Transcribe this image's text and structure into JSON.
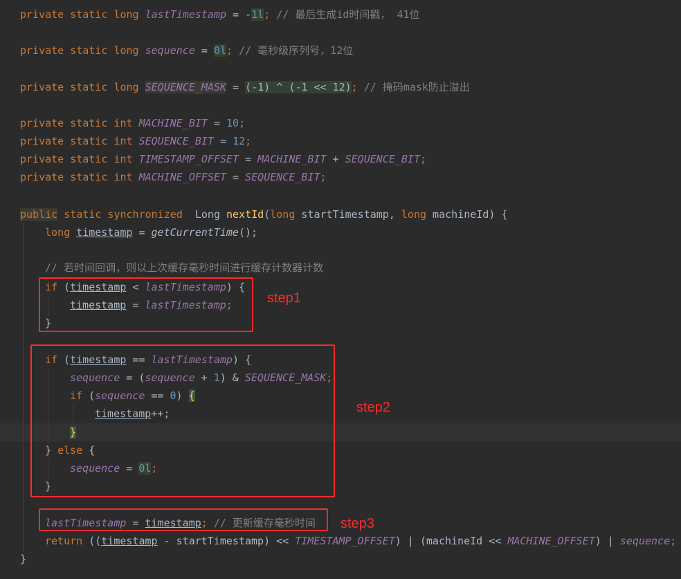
{
  "code": {
    "l1": {
      "a": "private static long ",
      "b": "lastTimestamp",
      "c": " = -",
      "d": "1l",
      "e": "; ",
      "f": "// 最后生成id时间戳， 41位"
    },
    "l2": {
      "a": "private static long ",
      "b": "sequence",
      "c": " = ",
      "d": "0l",
      "e": "; ",
      "f": "// 毫秒级序列号，12位"
    },
    "l3": {
      "a": "private static long ",
      "b": "SEQUENCE_MASK",
      "c": " = ",
      "d": "(-1) ^ (-1 << 12)",
      "e": "; ",
      "f": "// 掩码mask防止溢出"
    },
    "l4": {
      "a": "private static int ",
      "b": "MACHINE_BIT",
      "c": " = ",
      "d": "10",
      "e": ";"
    },
    "l5": {
      "a": "private static int ",
      "b": "SEQUENCE_BIT",
      "c": " = ",
      "d": "12",
      "e": ";"
    },
    "l6": {
      "a": "private static int ",
      "b": "TIMESTAMP_OFFSET",
      "c": " = ",
      "d": "MACHINE_BIT",
      "e": " + ",
      "f": "SEQUENCE_BIT",
      "g": ";"
    },
    "l7": {
      "a": "private static int ",
      "b": "MACHINE_OFFSET",
      "c": " = ",
      "d": "SEQUENCE_BIT",
      "e": ";"
    },
    "l8": {
      "a": "public",
      "b": " static synchronized ",
      "c": " Long ",
      "d": "nextId",
      "e": "(",
      "f": "long",
      "g": " startTimestamp, ",
      "h": "long",
      "i": " machineId) {"
    },
    "l9": {
      "a": "long ",
      "b": "timestamp",
      "c": " = ",
      "d": "getCurrentTime",
      "e": "();"
    },
    "l10": {
      "a": "// 若时间回调，则以上次缓存毫秒时间进行缓存计数器计数"
    },
    "l11": {
      "a": "if",
      "b": " (",
      "c": "timestamp",
      "d": " < ",
      "e": "lastTimestamp",
      "f": ") {"
    },
    "l12": {
      "a": "timestamp",
      "b": " = ",
      "c": "lastTimestamp",
      "d": ";"
    },
    "l13": {
      "a": "}"
    },
    "l14": {
      "a": "if",
      "b": " (",
      "c": "timestamp",
      "d": " == ",
      "e": "lastTimestamp",
      "f": ") {"
    },
    "l15": {
      "a": "sequence",
      "b": " = (",
      "c": "sequence",
      "d": " + ",
      "e": "1",
      "f": ") & ",
      "g": "SEQUENCE_MASK",
      "h": ";"
    },
    "l16": {
      "a": "if",
      "b": " (",
      "c": "sequence",
      "d": " == ",
      "e": "0",
      "f": ") ",
      "g": "{"
    },
    "l17": {
      "a": "timestamp",
      "b": "++;"
    },
    "l18": {
      "a": "}"
    },
    "l19": {
      "a": "} ",
      "b": "else",
      "c": " {"
    },
    "l20": {
      "a": "sequence",
      "b": " = ",
      "c": "0l",
      "d": ";"
    },
    "l21": {
      "a": "}"
    },
    "l22": {
      "a": "lastTimestamp",
      "b": " = ",
      "c": "timestamp",
      "d": "; ",
      "e": "// 更新缓存毫秒时间"
    },
    "l23": {
      "a": "return",
      "b": " ((",
      "c": "timestamp",
      "d": " - startTimestamp) << ",
      "e": "TIMESTAMP_OFFSET",
      "f": ") | (machineId << ",
      "g": "MACHINE_OFFSET",
      "h": ") | ",
      "i": "sequence",
      "j": ";"
    },
    "l24": {
      "a": "}"
    }
  },
  "annotations": {
    "step1": "step1",
    "step2": "step2",
    "step3": "step3"
  },
  "colors": {
    "background": "#2b2b2b",
    "keyword": "#cc7832",
    "number": "#6897bb",
    "comment": "#808080",
    "field": "#9876aa",
    "method": "#ffc66d",
    "annotation": "#ff2b2b"
  }
}
